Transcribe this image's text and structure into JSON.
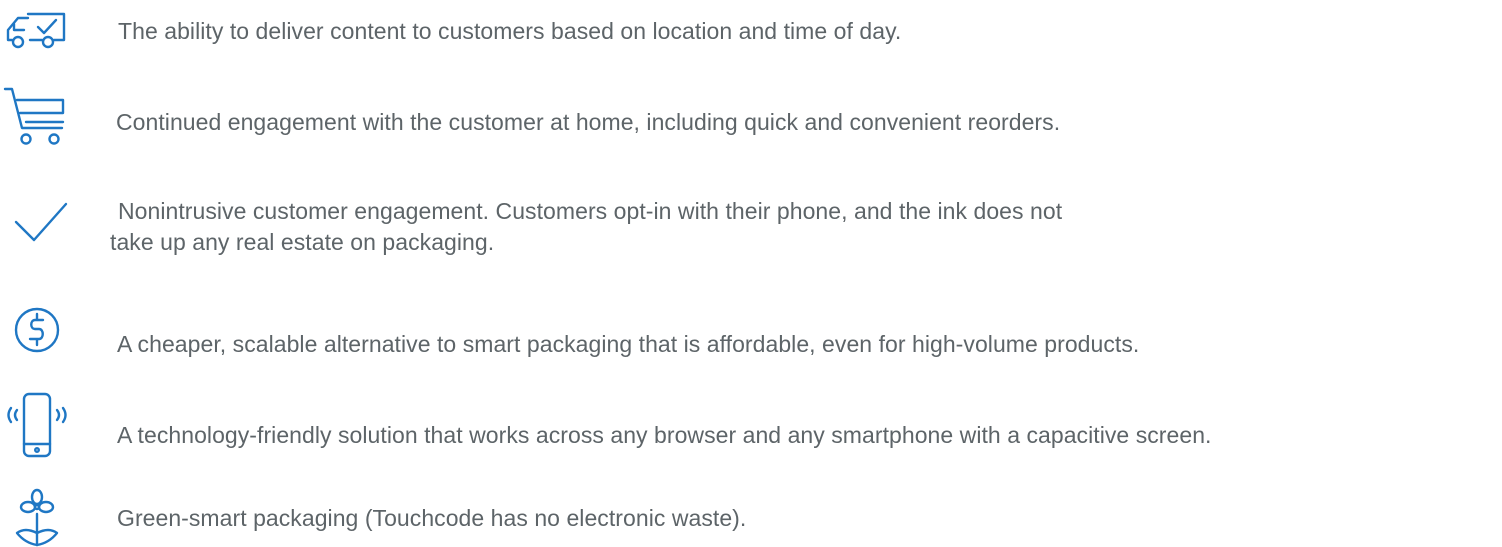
{
  "accent_color": "#1f77c4",
  "text_color": "#5d6468",
  "items": [
    {
      "icon": "delivery-truck-check-icon",
      "text": "The ability to deliver content to customers based on location and time of day."
    },
    {
      "icon": "shopping-cart-icon",
      "text": "Continued engagement with the customer at home, including quick and convenient reorders."
    },
    {
      "icon": "checkmark-icon",
      "text": "Nonintrusive customer engagement. Customers opt-in with their phone, and the ink does not",
      "text_line2": "take up any real estate on packaging."
    },
    {
      "icon": "dollar-coin-icon",
      "text": "A cheaper, scalable alternative to smart packaging that is affordable, even for high-volume products."
    },
    {
      "icon": "vibrating-smartphone-icon",
      "text": "A technology-friendly solution that works across any browser and any smartphone with a capacitive screen."
    },
    {
      "icon": "sprout-plant-icon",
      "text": "Green-smart packaging (Touchcode has no electronic waste)."
    }
  ]
}
